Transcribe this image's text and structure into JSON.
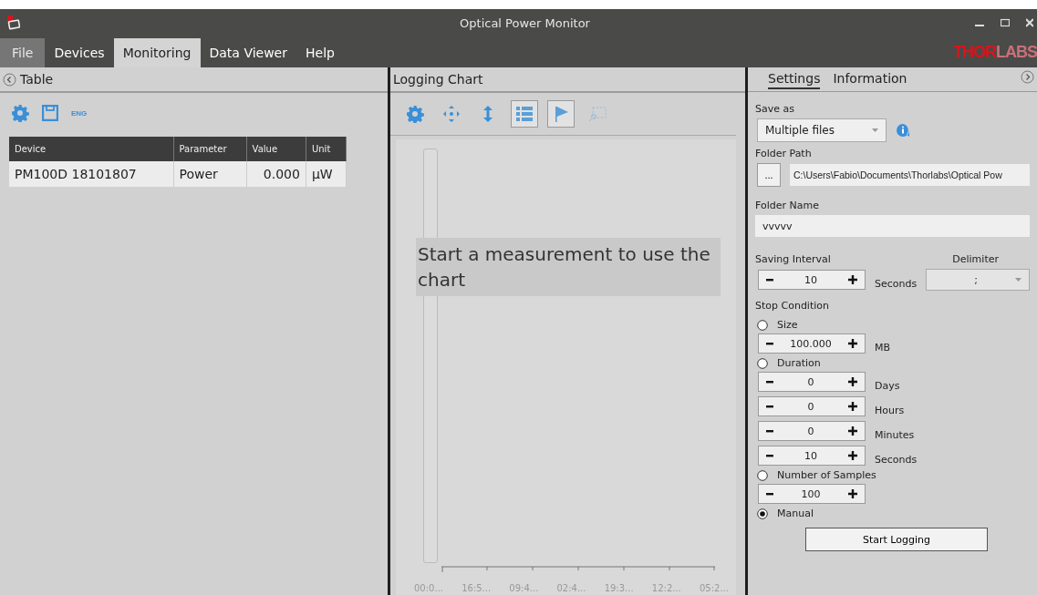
{
  "window": {
    "title": "Optical Power Monitor"
  },
  "menu": [
    {
      "label": "File",
      "kind": "file",
      "selected": false
    },
    {
      "label": "Devices",
      "kind": "tab",
      "selected": false
    },
    {
      "label": "Monitoring",
      "kind": "tab",
      "selected": true
    },
    {
      "label": "Data Viewer",
      "kind": "tab",
      "selected": false
    },
    {
      "label": "Help",
      "kind": "tab",
      "selected": false
    }
  ],
  "logo": {
    "strong": "THOR",
    "faint": "LABS"
  },
  "table_panel": {
    "title": "Table",
    "language": "ENG",
    "columns": [
      "Device",
      "Parameter",
      "Value",
      "Unit"
    ],
    "rows": [
      {
        "device": "PM100D 18101807",
        "parameter": "Power",
        "value": "0.000",
        "unit": "µW"
      }
    ]
  },
  "chart_panel": {
    "title": "Logging Chart",
    "tools": [
      {
        "kind": "gear",
        "pressed": false,
        "disabled": false
      },
      {
        "kind": "move",
        "pressed": false,
        "disabled": false
      },
      {
        "kind": "vertical",
        "pressed": false,
        "disabled": false
      },
      {
        "kind": "list",
        "pressed": true,
        "disabled": false
      },
      {
        "kind": "flag",
        "pressed": true,
        "disabled": false
      },
      {
        "kind": "zoom",
        "pressed": false,
        "disabled": true
      }
    ],
    "message": "Start a measurement to use the chart",
    "x_labels": [
      "00:0...",
      "16:5...",
      "09:4...",
      "02:4...",
      "19:3...",
      "12:2...",
      "05:2..."
    ]
  },
  "settings_panel": {
    "tabs": [
      {
        "label": "Settings",
        "selected": true
      },
      {
        "label": "Information",
        "selected": false
      }
    ],
    "save_as": {
      "label": "Save as",
      "value": "Multiple files"
    },
    "folder_path": {
      "label": "Folder Path",
      "browse": "...",
      "value": "C:\\Users\\Fabio\\Documents\\Thorlabs\\Optical Pow"
    },
    "folder_name": {
      "label": "Folder Name",
      "value": "vvvvv"
    },
    "saving_interval": {
      "label": "Saving Interval",
      "value": "10",
      "unit": "Seconds"
    },
    "delimiter": {
      "label": "Delimiter",
      "value": ";"
    },
    "stop_condition": {
      "label": "Stop Condition",
      "options": [
        {
          "label": "Size",
          "selected": false,
          "steppers": [
            {
              "value": "100.000",
              "unit": "MB"
            }
          ]
        },
        {
          "label": "Duration",
          "selected": false,
          "steppers": [
            {
              "value": "0",
              "unit": "Days"
            },
            {
              "value": "0",
              "unit": "Hours"
            },
            {
              "value": "0",
              "unit": "Minutes"
            },
            {
              "value": "10",
              "unit": "Seconds"
            }
          ]
        },
        {
          "label": "Number of Samples",
          "selected": false,
          "steppers": [
            {
              "value": "100"
            }
          ]
        },
        {
          "label": "Manual",
          "selected": true
        }
      ]
    },
    "start_button": "Start Logging"
  }
}
